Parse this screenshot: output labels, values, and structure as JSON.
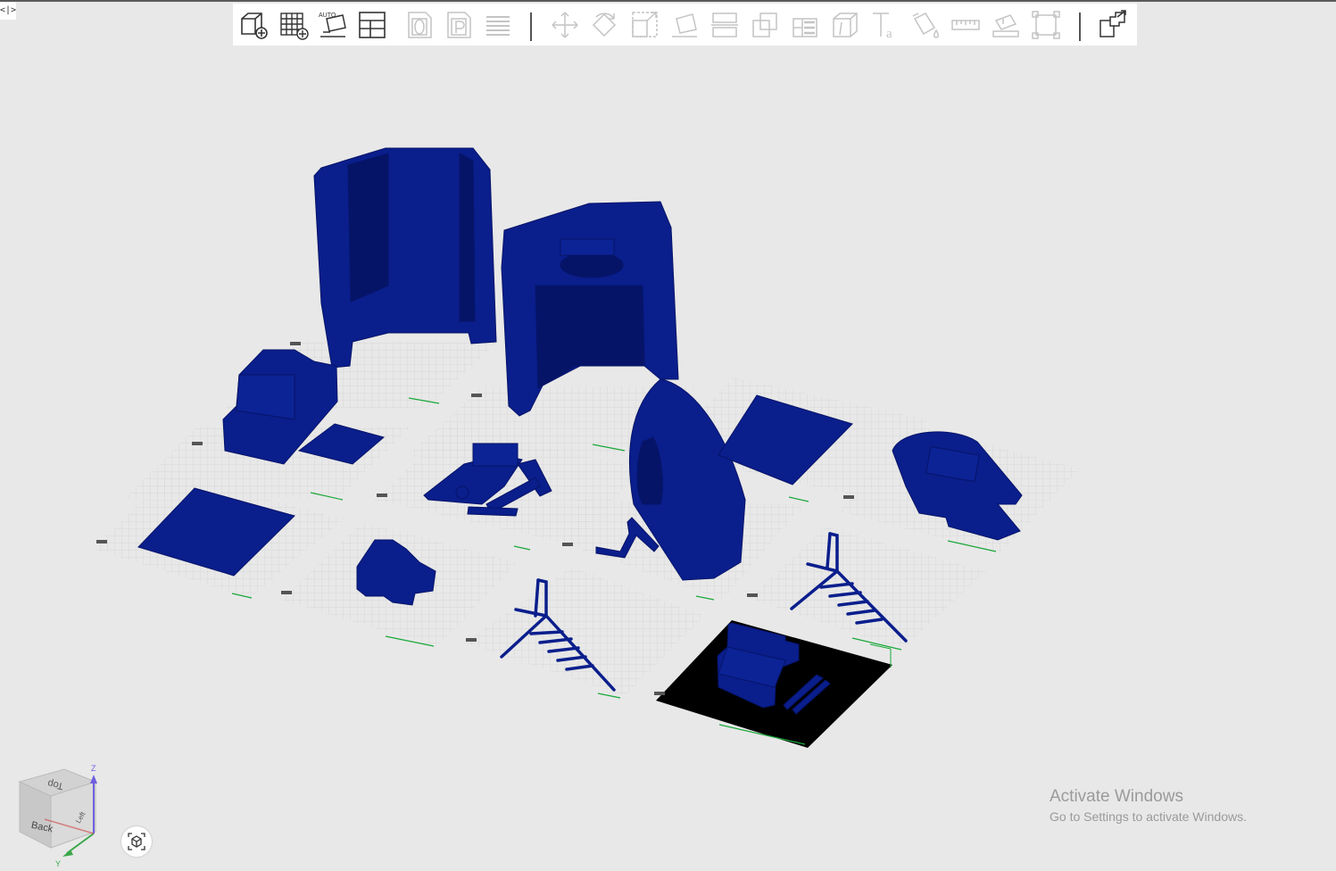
{
  "sidebar_toggle": {
    "label": "<|>"
  },
  "toolbar": {
    "auto_label": "AUTO",
    "text_tool_glyph": "Ta",
    "tools": [
      {
        "name": "add-model",
        "icon": "cube-plus-icon",
        "enabled": true
      },
      {
        "name": "add-plate",
        "icon": "grid-plus-icon",
        "enabled": true
      },
      {
        "name": "auto-layout",
        "icon": "auto-layout-icon",
        "enabled": true
      },
      {
        "name": "layout-panel",
        "icon": "layout-panel-icon",
        "enabled": true
      },
      {
        "name": "orient",
        "icon": "zero-doc-icon",
        "enabled": false
      },
      {
        "name": "place",
        "icon": "p-doc-icon",
        "enabled": false
      },
      {
        "name": "slice-list",
        "icon": "list-icon",
        "enabled": false
      },
      {
        "name": "move",
        "icon": "move-icon",
        "enabled": false
      },
      {
        "name": "rotate",
        "icon": "rotate-icon",
        "enabled": false
      },
      {
        "name": "scale",
        "icon": "scale-icon",
        "enabled": false
      },
      {
        "name": "lay-on-face",
        "icon": "lay-flat-icon",
        "enabled": false
      },
      {
        "name": "cut",
        "icon": "cut-icon",
        "enabled": false
      },
      {
        "name": "boolean",
        "icon": "boolean-icon",
        "enabled": false
      },
      {
        "name": "support-paint",
        "icon": "support-paint-icon",
        "enabled": false
      },
      {
        "name": "seam",
        "icon": "seam-icon",
        "enabled": false
      },
      {
        "name": "text",
        "icon": "text-icon",
        "enabled": false
      },
      {
        "name": "color-paint",
        "icon": "paint-bucket-icon",
        "enabled": false
      },
      {
        "name": "measure",
        "icon": "ruler-icon",
        "enabled": false
      },
      {
        "name": "assembly",
        "icon": "assembly-icon",
        "enabled": false
      },
      {
        "name": "fit-view",
        "icon": "fit-view-icon",
        "enabled": false
      },
      {
        "name": "split-to-objects",
        "icon": "split-objects-icon",
        "enabled": true
      }
    ]
  },
  "colors": {
    "background": "#e8e8e8",
    "model": "#0a1e8c",
    "model_dark": "#061468",
    "plate_grid": "#d2d2d2",
    "selected_plate": "#000000",
    "label_green": "#1aa83a"
  },
  "viewcube": {
    "faces": {
      "top": "Top",
      "front": "Back",
      "side": "Left"
    },
    "axes": {
      "z": "Z",
      "y": "Y"
    }
  },
  "watermark": {
    "title": "Activate Windows",
    "subtitle": "Go to Settings to activate Windows."
  }
}
